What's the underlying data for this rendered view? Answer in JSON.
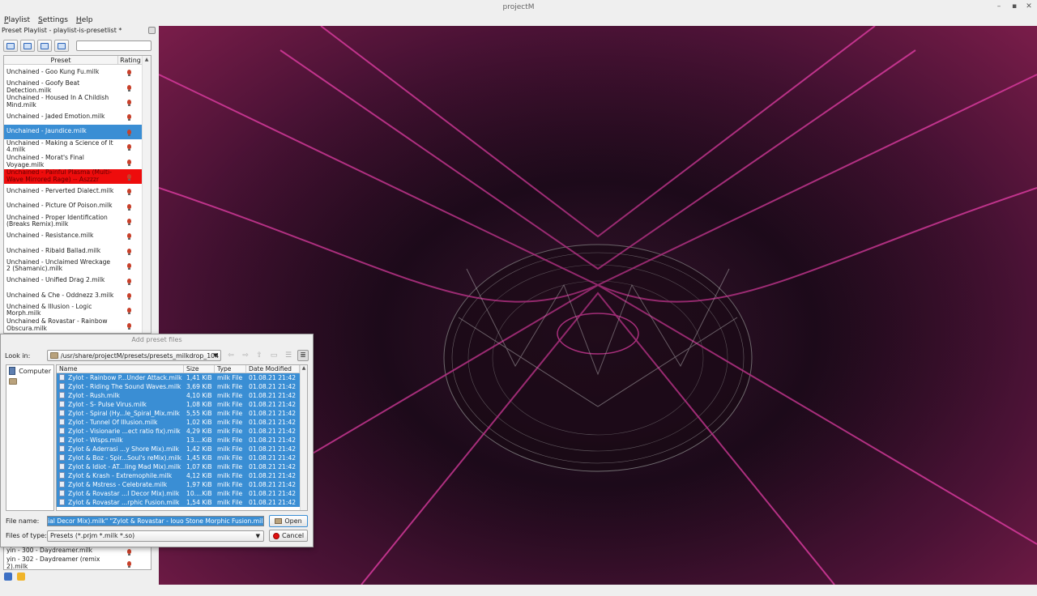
{
  "window": {
    "title": "projectM"
  },
  "menu": [
    "Playlist",
    "Settings",
    "Help"
  ],
  "dock": {
    "title": "Preset Playlist - playlist-is-presetlist *",
    "columns": {
      "preset": "Preset",
      "rating": "Rating"
    },
    "toolbar_icons": [
      "add-preset-icon",
      "edit-icon",
      "save-icon",
      "open-playlist-icon"
    ],
    "presets": [
      {
        "name": "Unchained - Goo Kung Fu.milk",
        "state": "normal"
      },
      {
        "name": "Unchained - Goofy Beat Detection.milk",
        "state": "normal"
      },
      {
        "name": "Unchained - Housed In A Childish Mind.milk",
        "state": "normal"
      },
      {
        "name": "Unchained - Jaded Emotion.milk",
        "state": "normal"
      },
      {
        "name": "Unchained - Jaundice.milk",
        "state": "selected"
      },
      {
        "name": "Unchained - Making a Science of It 4.milk",
        "state": "normal"
      },
      {
        "name": "Unchained - Morat's Final Voyage.milk",
        "state": "normal"
      },
      {
        "name": "Unchained - Painful Plasma (Multi-Wave Mirrored Rage) -- Aszzzr",
        "state": "error"
      },
      {
        "name": "Unchained - Perverted Dialect.milk",
        "state": "normal"
      },
      {
        "name": "Unchained - Picture Of Poison.milk",
        "state": "normal"
      },
      {
        "name": "Unchained - Proper Identification (Breaks Remix).milk",
        "state": "normal"
      },
      {
        "name": "Unchained - Resistance.milk",
        "state": "normal"
      },
      {
        "name": "Unchained - Ribald Ballad.milk",
        "state": "normal"
      },
      {
        "name": "Unchained - Unclaimed Wreckage 2 (Shamanic).milk",
        "state": "normal"
      },
      {
        "name": "Unchained - Unified Drag 2.milk",
        "state": "normal"
      },
      {
        "name": "Unchained & Che - Oddnezz 3.milk",
        "state": "normal"
      },
      {
        "name": "Unchained & Illusion - Logic Morph.milk",
        "state": "normal"
      },
      {
        "name": "Unchained & Rovastar - Rainbow Obscura.milk",
        "state": "normal"
      }
    ],
    "tail_presets": [
      {
        "name": "yin - 300 - Daydreamer.milk"
      },
      {
        "name": "yin - 302 - Daydreamer (remix 2).milk"
      }
    ]
  },
  "dialog": {
    "title": "Add preset files",
    "look_in_label": "Look in:",
    "look_in_path": "/usr/share/projectM/presets/presets_milkdrop_104",
    "sidebar": {
      "computer": "Computer"
    },
    "columns": {
      "name": "Name",
      "size": "Size",
      "type": "Type",
      "date": "Date Modified"
    },
    "files": [
      {
        "name": "Zylot - Rainbow P...Under Attack.milk",
        "size": "1,41 KiB",
        "type": "milk File",
        "date": "01.08.21 21:42"
      },
      {
        "name": "Zylot - Riding The Sound Waves.milk",
        "size": "3,69 KiB",
        "type": "milk File",
        "date": "01.08.21 21:42"
      },
      {
        "name": "Zylot - Rush.milk",
        "size": "4,10 KiB",
        "type": "milk File",
        "date": "01.08.21 21:42"
      },
      {
        "name": "Zylot - S- Pulse Virus.milk",
        "size": "1,08 KiB",
        "type": "milk File",
        "date": "01.08.21 21:42"
      },
      {
        "name": "Zylot - Spiral (Hy...le_Spiral_Mix.milk",
        "size": "5,55 KiB",
        "type": "milk File",
        "date": "01.08.21 21:42"
      },
      {
        "name": "Zylot - Tunnel Of Illusion.milk",
        "size": "1,02 KiB",
        "type": "milk File",
        "date": "01.08.21 21:42"
      },
      {
        "name": "Zylot - Visionarie ...ect ratio fix).milk",
        "size": "4,29 KiB",
        "type": "milk File",
        "date": "01.08.21 21:42"
      },
      {
        "name": "Zylot - Wisps.milk",
        "size": "13....KiB",
        "type": "milk File",
        "date": "01.08.21 21:42"
      },
      {
        "name": "Zylot & Aderrasi ...y Shore Mix).milk",
        "size": "1,42 KiB",
        "type": "milk File",
        "date": "01.08.21 21:42"
      },
      {
        "name": "Zylot & Boz - Spir...Soul's reMix).milk",
        "size": "1,45 KiB",
        "type": "milk File",
        "date": "01.08.21 21:42"
      },
      {
        "name": "Zylot & Idiot - AT...ling Mad Mix).milk",
        "size": "1,07 KiB",
        "type": "milk File",
        "date": "01.08.21 21:42"
      },
      {
        "name": "Zylot & Krash - Extremophile.milk",
        "size": "4,12 KiB",
        "type": "milk File",
        "date": "01.08.21 21:42"
      },
      {
        "name": "Zylot & Mstress - Celebrate.milk",
        "size": "1,97 KiB",
        "type": "milk File",
        "date": "01.08.21 21:42"
      },
      {
        "name": "Zylot & Rovastar ...l Decor Mix).milk",
        "size": "10....KiB",
        "type": "milk File",
        "date": "01.08.21 21:42"
      },
      {
        "name": "Zylot & Rovastar ...rphic Fusion.milk",
        "size": "1,54 KiB",
        "type": "milk File",
        "date": "01.08.21 21:42"
      }
    ],
    "file_name_label": "File name:",
    "file_name_value": "ial Decor Mix).milk\" \"Zylot & Rovastar - Iouo Stone Morphic Fusion.milk\"",
    "files_of_type_label": "Files of type:",
    "files_of_type_value": "Presets (*.prjm *.milk *.so)",
    "open_label": "Open",
    "cancel_label": "Cancel"
  },
  "colors": {
    "selection": "#3a8ed4",
    "error_row": "#ee0c0c",
    "viz_magenta": "#d63a9c"
  }
}
